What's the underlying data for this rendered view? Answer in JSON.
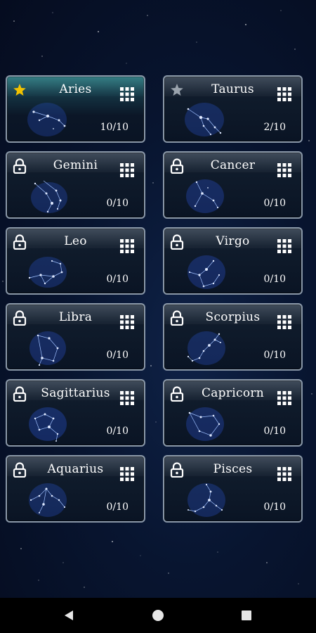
{
  "cards": [
    {
      "name": "Aries",
      "progress": "10/10",
      "status": "star-gold"
    },
    {
      "name": "Taurus",
      "progress": "2/10",
      "status": "star-gray"
    },
    {
      "name": "Gemini",
      "progress": "0/10",
      "status": "lock"
    },
    {
      "name": "Cancer",
      "progress": "0/10",
      "status": "lock"
    },
    {
      "name": "Leo",
      "progress": "0/10",
      "status": "lock"
    },
    {
      "name": "Virgo",
      "progress": "0/10",
      "status": "lock"
    },
    {
      "name": "Libra",
      "progress": "0/10",
      "status": "lock"
    },
    {
      "name": "Scorpius",
      "progress": "0/10",
      "status": "lock"
    },
    {
      "name": "Sagittarius",
      "progress": "0/10",
      "status": "lock"
    },
    {
      "name": "Capricorn",
      "progress": "0/10",
      "status": "lock"
    },
    {
      "name": "Aquarius",
      "progress": "0/10",
      "status": "lock"
    },
    {
      "name": "Pisces",
      "progress": "0/10",
      "status": "lock"
    }
  ],
  "icons": {
    "level_grid": "grid-icon",
    "nav_back": "back-triangle-icon",
    "nav_home": "home-circle-icon",
    "nav_recents": "recents-square-icon"
  },
  "colors": {
    "star_gold": "#f2c200",
    "star_gray": "#9aa3ad",
    "constellation": "#4a7dff"
  }
}
